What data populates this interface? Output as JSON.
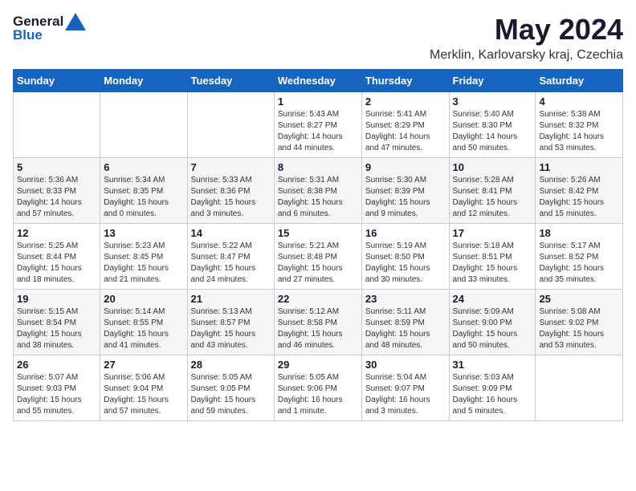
{
  "logo": {
    "general": "General",
    "blue": "Blue"
  },
  "title": "May 2024",
  "subtitle": "Merklin, Karlovarsky kraj, Czechia",
  "weekdays": [
    "Sunday",
    "Monday",
    "Tuesday",
    "Wednesday",
    "Thursday",
    "Friday",
    "Saturday"
  ],
  "weeks": [
    [
      {
        "day": "",
        "info": ""
      },
      {
        "day": "",
        "info": ""
      },
      {
        "day": "",
        "info": ""
      },
      {
        "day": "1",
        "info": "Sunrise: 5:43 AM\nSunset: 8:27 PM\nDaylight: 14 hours\nand 44 minutes."
      },
      {
        "day": "2",
        "info": "Sunrise: 5:41 AM\nSunset: 8:29 PM\nDaylight: 14 hours\nand 47 minutes."
      },
      {
        "day": "3",
        "info": "Sunrise: 5:40 AM\nSunset: 8:30 PM\nDaylight: 14 hours\nand 50 minutes."
      },
      {
        "day": "4",
        "info": "Sunrise: 5:38 AM\nSunset: 8:32 PM\nDaylight: 14 hours\nand 53 minutes."
      }
    ],
    [
      {
        "day": "5",
        "info": "Sunrise: 5:36 AM\nSunset: 8:33 PM\nDaylight: 14 hours\nand 57 minutes."
      },
      {
        "day": "6",
        "info": "Sunrise: 5:34 AM\nSunset: 8:35 PM\nDaylight: 15 hours\nand 0 minutes."
      },
      {
        "day": "7",
        "info": "Sunrise: 5:33 AM\nSunset: 8:36 PM\nDaylight: 15 hours\nand 3 minutes."
      },
      {
        "day": "8",
        "info": "Sunrise: 5:31 AM\nSunset: 8:38 PM\nDaylight: 15 hours\nand 6 minutes."
      },
      {
        "day": "9",
        "info": "Sunrise: 5:30 AM\nSunset: 8:39 PM\nDaylight: 15 hours\nand 9 minutes."
      },
      {
        "day": "10",
        "info": "Sunrise: 5:28 AM\nSunset: 8:41 PM\nDaylight: 15 hours\nand 12 minutes."
      },
      {
        "day": "11",
        "info": "Sunrise: 5:26 AM\nSunset: 8:42 PM\nDaylight: 15 hours\nand 15 minutes."
      }
    ],
    [
      {
        "day": "12",
        "info": "Sunrise: 5:25 AM\nSunset: 8:44 PM\nDaylight: 15 hours\nand 18 minutes."
      },
      {
        "day": "13",
        "info": "Sunrise: 5:23 AM\nSunset: 8:45 PM\nDaylight: 15 hours\nand 21 minutes."
      },
      {
        "day": "14",
        "info": "Sunrise: 5:22 AM\nSunset: 8:47 PM\nDaylight: 15 hours\nand 24 minutes."
      },
      {
        "day": "15",
        "info": "Sunrise: 5:21 AM\nSunset: 8:48 PM\nDaylight: 15 hours\nand 27 minutes."
      },
      {
        "day": "16",
        "info": "Sunrise: 5:19 AM\nSunset: 8:50 PM\nDaylight: 15 hours\nand 30 minutes."
      },
      {
        "day": "17",
        "info": "Sunrise: 5:18 AM\nSunset: 8:51 PM\nDaylight: 15 hours\nand 33 minutes."
      },
      {
        "day": "18",
        "info": "Sunrise: 5:17 AM\nSunset: 8:52 PM\nDaylight: 15 hours\nand 35 minutes."
      }
    ],
    [
      {
        "day": "19",
        "info": "Sunrise: 5:15 AM\nSunset: 8:54 PM\nDaylight: 15 hours\nand 38 minutes."
      },
      {
        "day": "20",
        "info": "Sunrise: 5:14 AM\nSunset: 8:55 PM\nDaylight: 15 hours\nand 41 minutes."
      },
      {
        "day": "21",
        "info": "Sunrise: 5:13 AM\nSunset: 8:57 PM\nDaylight: 15 hours\nand 43 minutes."
      },
      {
        "day": "22",
        "info": "Sunrise: 5:12 AM\nSunset: 8:58 PM\nDaylight: 15 hours\nand 46 minutes."
      },
      {
        "day": "23",
        "info": "Sunrise: 5:11 AM\nSunset: 8:59 PM\nDaylight: 15 hours\nand 48 minutes."
      },
      {
        "day": "24",
        "info": "Sunrise: 5:09 AM\nSunset: 9:00 PM\nDaylight: 15 hours\nand 50 minutes."
      },
      {
        "day": "25",
        "info": "Sunrise: 5:08 AM\nSunset: 9:02 PM\nDaylight: 15 hours\nand 53 minutes."
      }
    ],
    [
      {
        "day": "26",
        "info": "Sunrise: 5:07 AM\nSunset: 9:03 PM\nDaylight: 15 hours\nand 55 minutes."
      },
      {
        "day": "27",
        "info": "Sunrise: 5:06 AM\nSunset: 9:04 PM\nDaylight: 15 hours\nand 57 minutes."
      },
      {
        "day": "28",
        "info": "Sunrise: 5:05 AM\nSunset: 9:05 PM\nDaylight: 15 hours\nand 59 minutes."
      },
      {
        "day": "29",
        "info": "Sunrise: 5:05 AM\nSunset: 9:06 PM\nDaylight: 16 hours\nand 1 minute."
      },
      {
        "day": "30",
        "info": "Sunrise: 5:04 AM\nSunset: 9:07 PM\nDaylight: 16 hours\nand 3 minutes."
      },
      {
        "day": "31",
        "info": "Sunrise: 5:03 AM\nSunset: 9:09 PM\nDaylight: 16 hours\nand 5 minutes."
      },
      {
        "day": "",
        "info": ""
      }
    ]
  ]
}
